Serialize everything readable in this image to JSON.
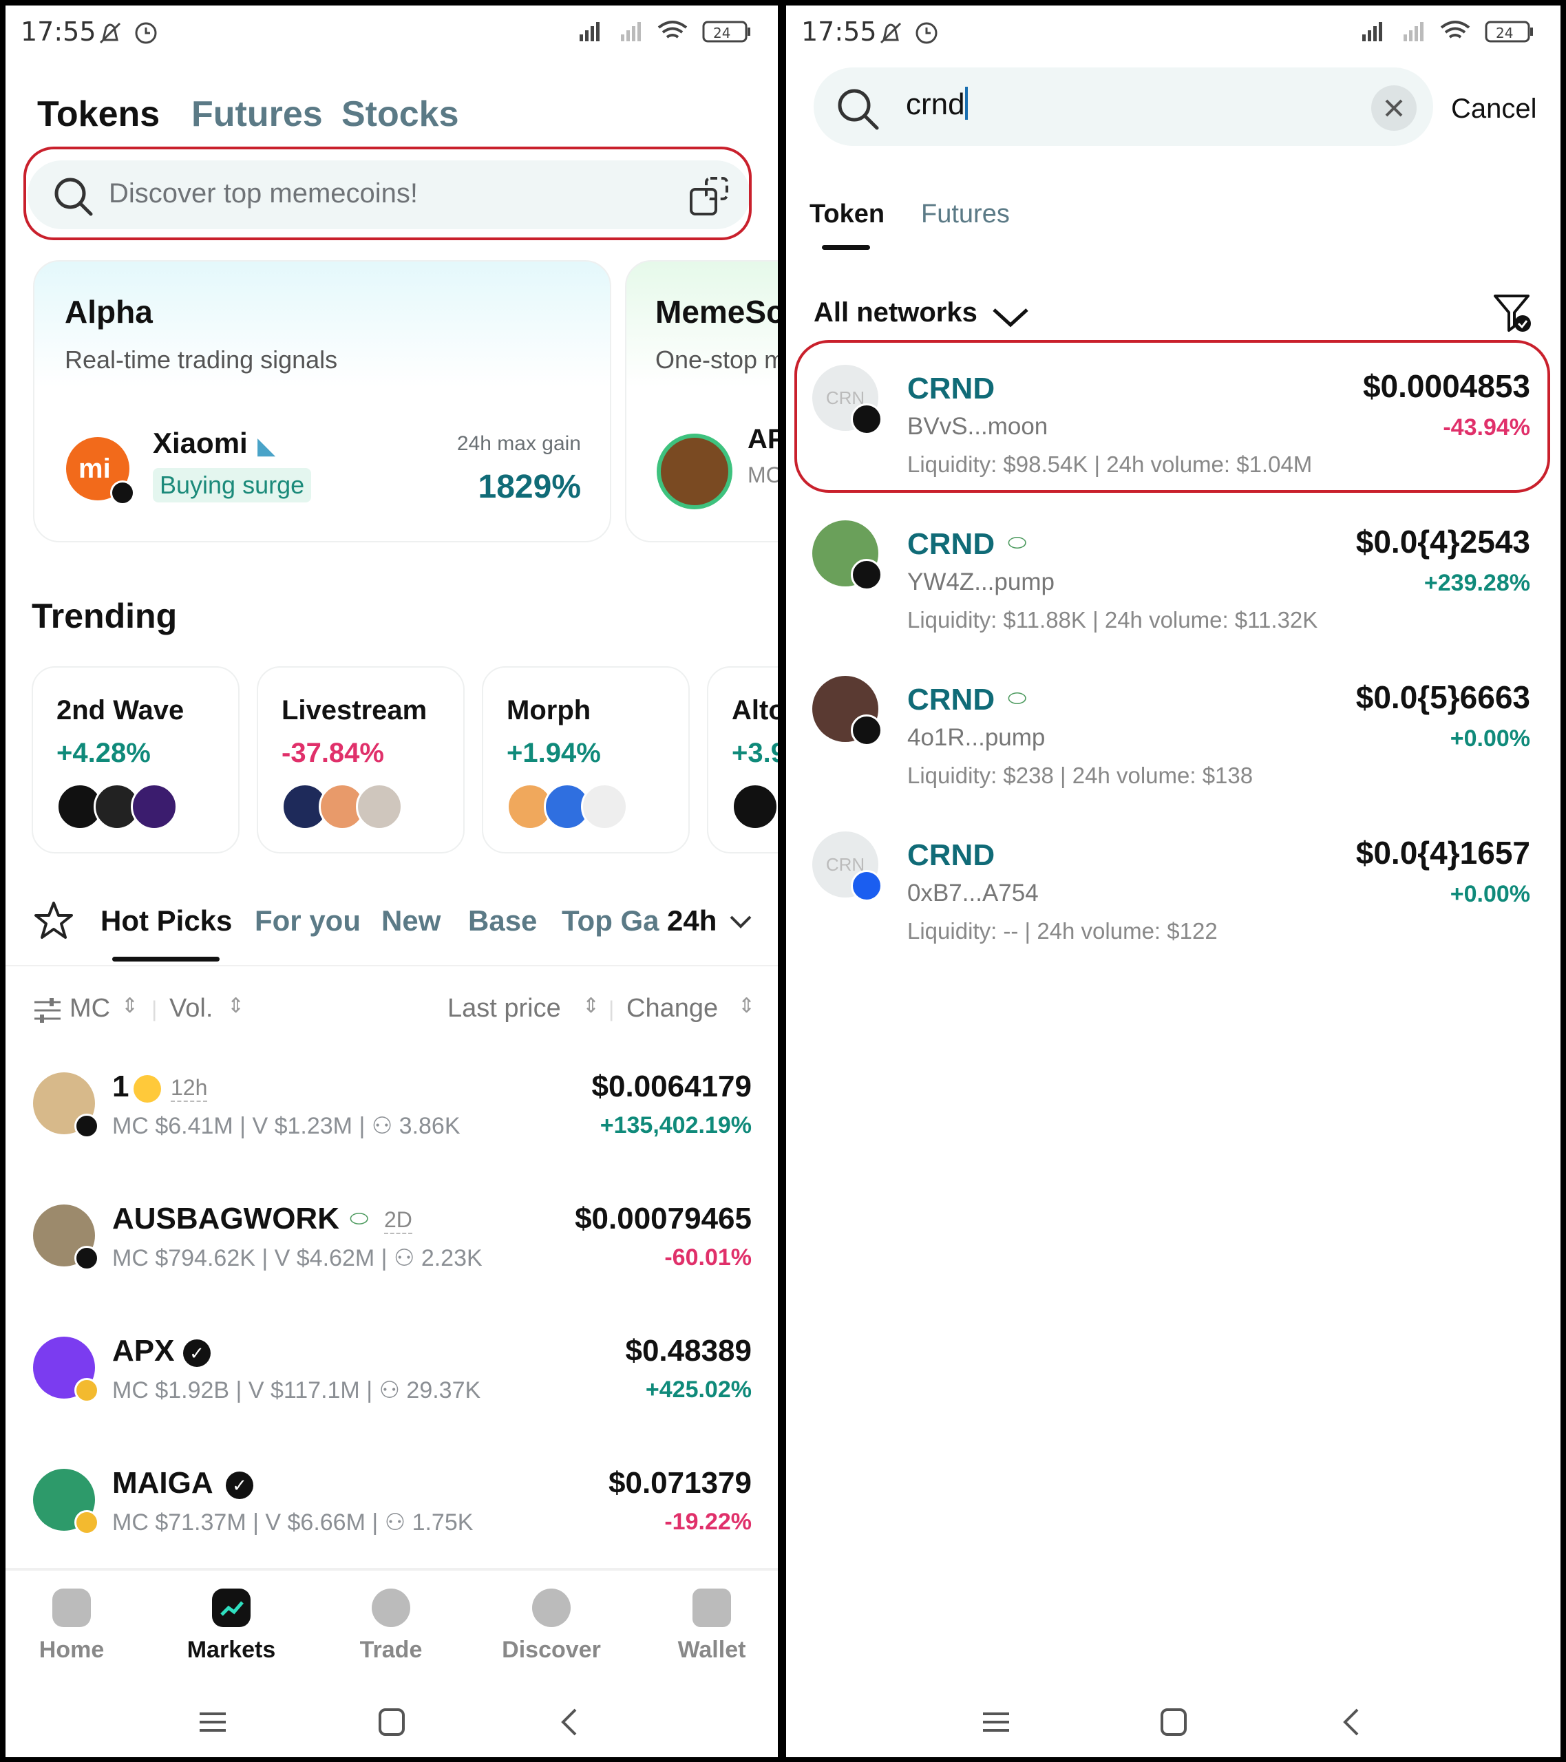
{
  "status": {
    "time": "17:55",
    "battery": "24"
  },
  "left": {
    "tabs": [
      "Tokens",
      "Futures",
      "Stocks"
    ],
    "search_placeholder": "Discover top memecoins!",
    "alpha": {
      "title": "Alpha",
      "subtitle": "Real-time trading signals",
      "token": "Xiaomi",
      "signal": "Buying surge",
      "gain_label": "24h max gain",
      "gain": "1829%"
    },
    "memes": {
      "title": "MemeSc",
      "subtitle": "One-stop m",
      "token": "AP",
      "mc": "MC"
    },
    "trending_title": "Trending",
    "trending": [
      {
        "name": "2nd Wave",
        "change": "+4.28%"
      },
      {
        "name": "Livestream",
        "change": "-37.84%"
      },
      {
        "name": "Morph",
        "change": "+1.94%"
      },
      {
        "name": "Alto",
        "change": "+3.9"
      }
    ],
    "list_tabs": [
      "Hot Picks",
      "For you",
      "New",
      "Base",
      "Top Ga"
    ],
    "period": "24h",
    "columns": {
      "mc": "MC",
      "vol": "Vol.",
      "price": "Last price",
      "change": "Change"
    },
    "tokens": [
      {
        "name": "1",
        "age": "12h",
        "mc": "MC $6.41M",
        "vol": "V $1.23M",
        "holders": "3.86K",
        "price": "$0.0064179",
        "change": "+135,402.19%"
      },
      {
        "name": "AUSBAGWORK",
        "age": "2D",
        "mc": "MC $794.62K",
        "vol": "V $4.62M",
        "holders": "2.23K",
        "price": "$0.00079465",
        "change": "-60.01%"
      },
      {
        "name": "APX",
        "age": "",
        "mc": "MC $1.92B",
        "vol": "V $117.1M",
        "holders": "29.37K",
        "price": "$0.48389",
        "change": "+425.02%"
      },
      {
        "name": "MAIGA",
        "age": "",
        "mc": "MC $71.37M",
        "vol": "V $6.66M",
        "holders": "1.75K",
        "price": "$0.071379",
        "change": "-19.22%"
      }
    ],
    "nav": [
      "Home",
      "Markets",
      "Trade",
      "Discover",
      "Wallet"
    ]
  },
  "right": {
    "query": "crnd",
    "cancel": "Cancel",
    "tabs": [
      "Token",
      "Futures"
    ],
    "network": "All networks",
    "results": [
      {
        "name": "CRND",
        "addr": "BVvS...moon",
        "liquidity": "Liquidity: $98.54K",
        "volume": "24h volume: $1.04M",
        "price": "$0.0004853",
        "change": "-43.94%",
        "logo_text": "CRN"
      },
      {
        "name": "CRND",
        "addr": "YW4Z...pump",
        "liquidity": "Liquidity: $11.88K",
        "volume": "24h volume: $11.32K",
        "price": "$0.0{4}2543",
        "change": "+239.28%"
      },
      {
        "name": "CRND",
        "addr": "4o1R...pump",
        "liquidity": "Liquidity: $238",
        "volume": "24h volume: $138",
        "price": "$0.0{5}6663",
        "change": "+0.00%"
      },
      {
        "name": "CRND",
        "addr": "0xB7...A754",
        "liquidity": "Liquidity: --",
        "volume": "24h volume: $122",
        "price": "$0.0{4}1657",
        "change": "+0.00%",
        "logo_text": "CRN"
      }
    ]
  }
}
